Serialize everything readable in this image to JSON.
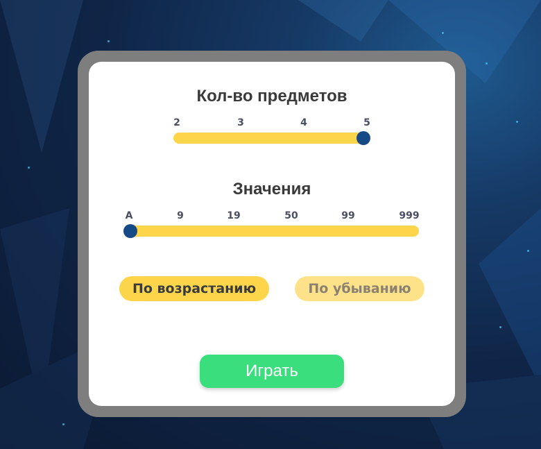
{
  "count_section": {
    "title": "Кол-во предметов",
    "ticks": [
      "2",
      "3",
      "4",
      "5"
    ],
    "selected": "5"
  },
  "values_section": {
    "title": "Значения",
    "ticks": [
      "A",
      "9",
      "19",
      "50",
      "99",
      "999"
    ],
    "selected": "A"
  },
  "sort": {
    "ascending_label": "По возрастанию",
    "descending_label": "По убыванию",
    "active": "ascending"
  },
  "play_label": "Играть",
  "colors": {
    "track": "#fdd54a",
    "knob": "#164a87",
    "play": "#3bde7c",
    "frame": "#7e7e7e"
  }
}
